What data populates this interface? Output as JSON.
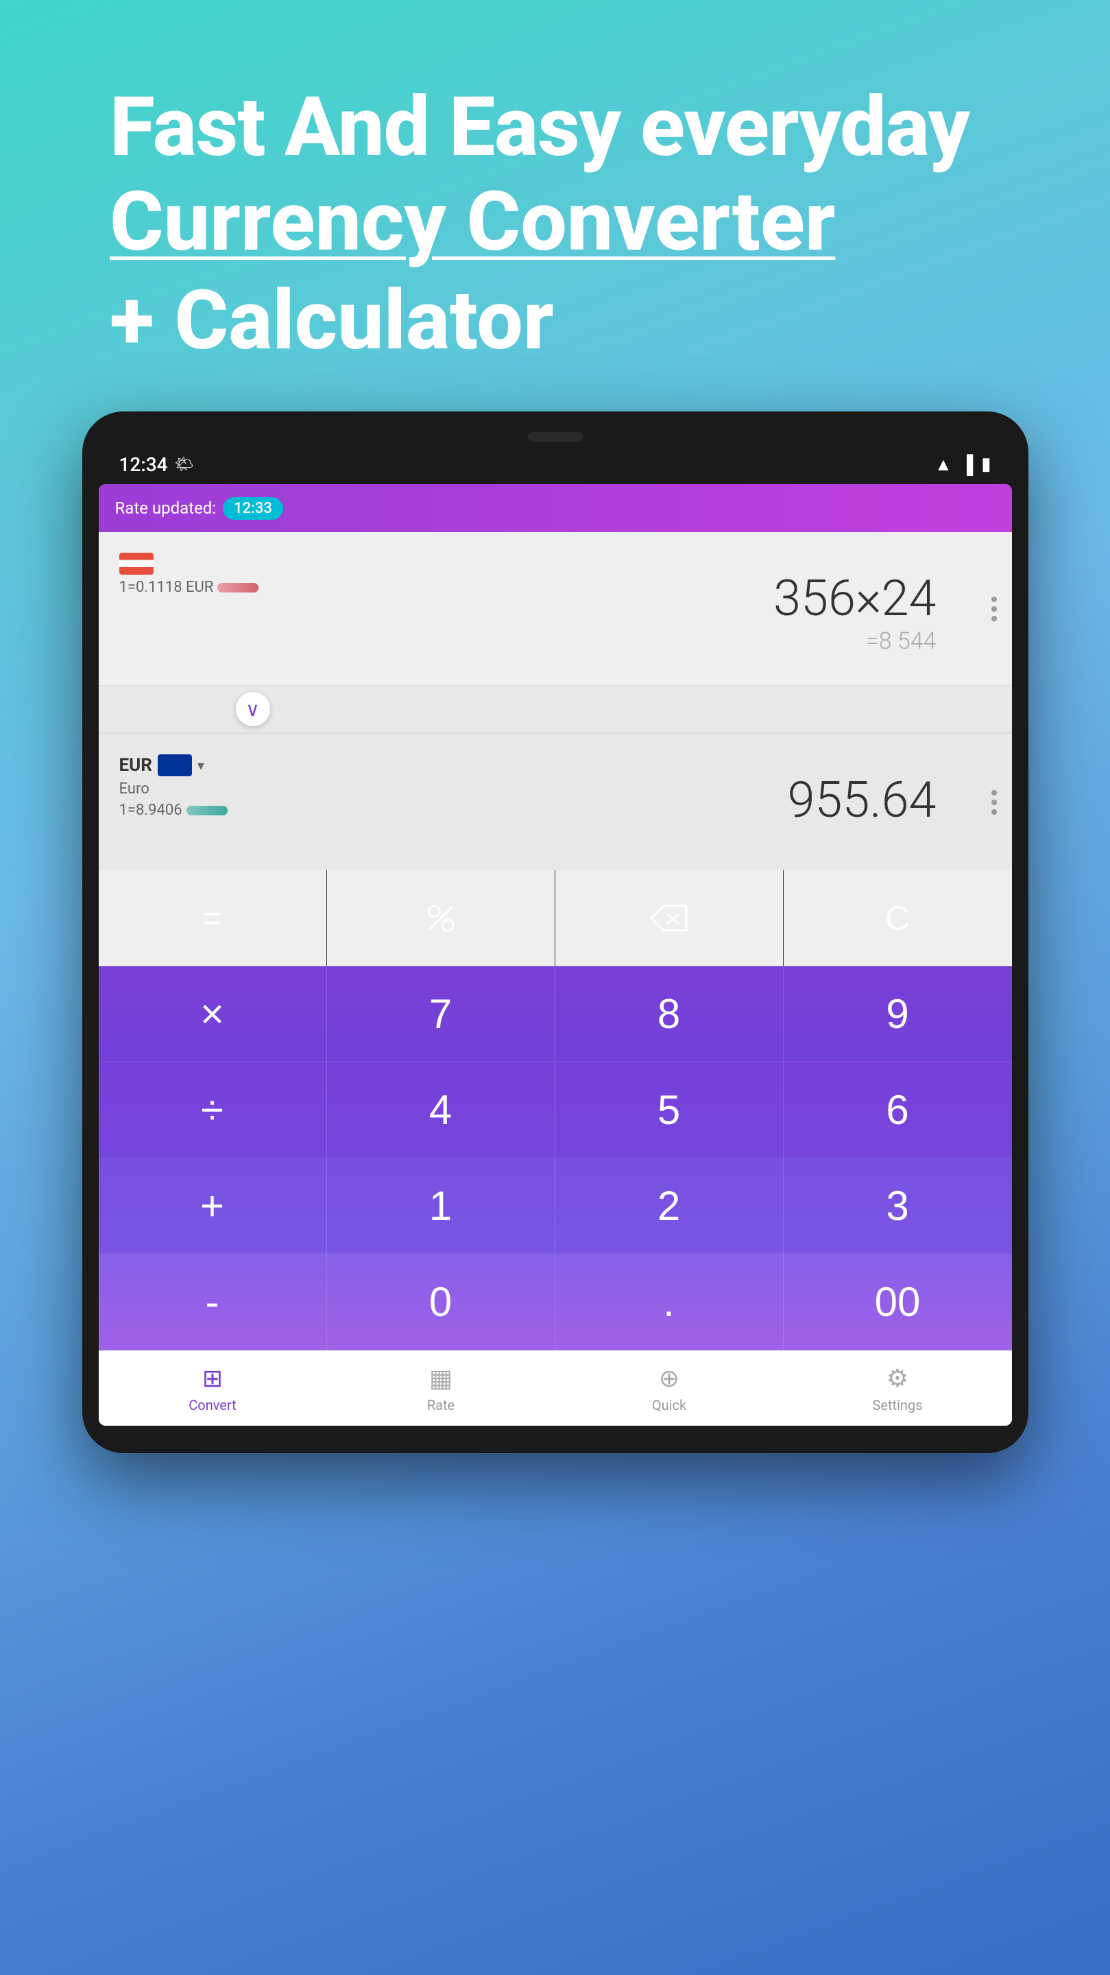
{
  "hero": {
    "line1": "Fast And Easy everyday",
    "line2": "Currency Converter",
    "line3": "+ Calculator"
  },
  "status_bar": {
    "time": "12:34",
    "icons": [
      "wifi",
      "signal",
      "battery"
    ]
  },
  "app_header": {
    "rate_label": "Rate updated:",
    "rate_time": "12:33"
  },
  "upper_currency": {
    "amount": "356×24",
    "result": "=8 544",
    "rate_text": "1=0.1118 EUR"
  },
  "lower_currency": {
    "code": "EUR",
    "name": "Euro",
    "rate_text": "1=8.9406",
    "amount": "955.64"
  },
  "calc_top_row": {
    "buttons": [
      "=",
      "%",
      "⌫",
      "C"
    ]
  },
  "calc_rows": [
    {
      "op": "×",
      "nums": [
        "7",
        "8",
        "9"
      ]
    },
    {
      "op": "÷",
      "nums": [
        "4",
        "5",
        "6"
      ]
    },
    {
      "op": "+",
      "nums": [
        "1",
        "2",
        "3"
      ]
    },
    {
      "op": "-",
      "nums": [
        "0",
        ".",
        "00"
      ]
    }
  ],
  "bottom_nav": [
    {
      "label": "Convert",
      "active": true
    },
    {
      "label": "Rate",
      "active": false
    },
    {
      "label": "Quick",
      "active": false
    },
    {
      "label": "Settings",
      "active": false
    }
  ]
}
